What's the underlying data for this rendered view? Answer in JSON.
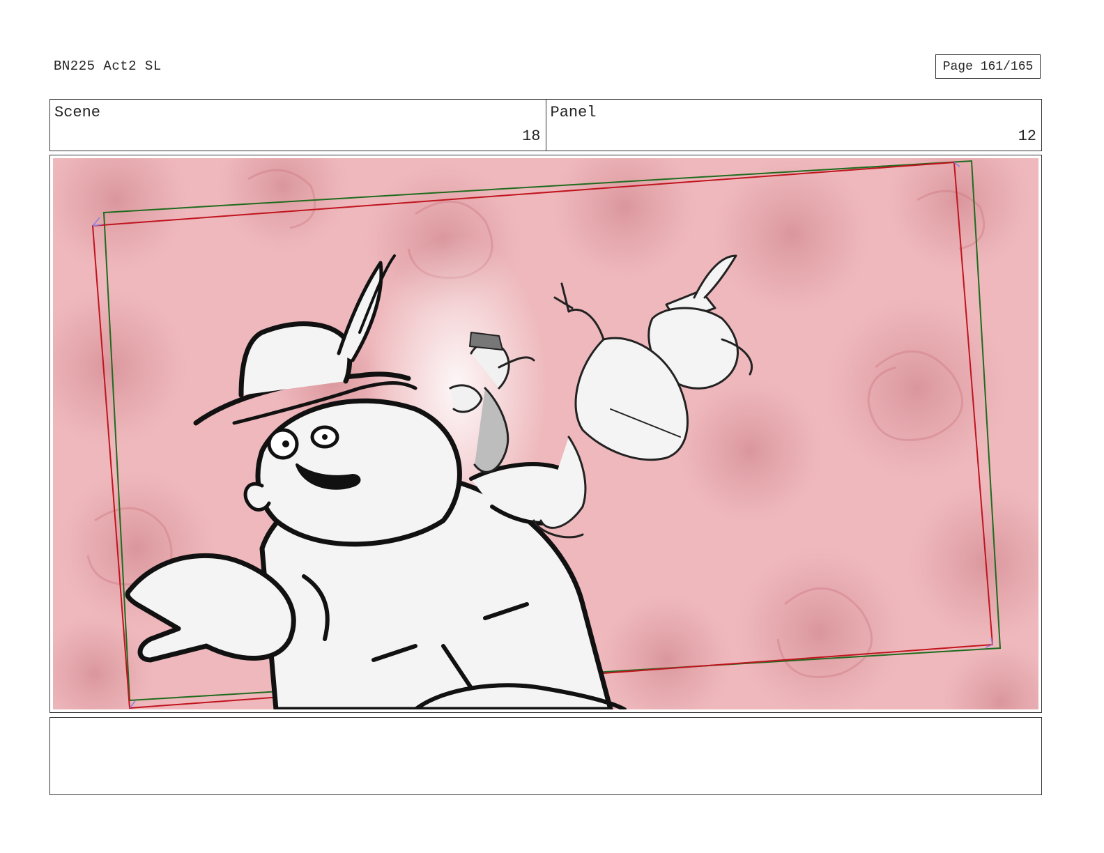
{
  "header": {
    "doc_title": "BN225 Act2 SL",
    "page_label": "Page 161/165"
  },
  "info": {
    "scene_label": "Scene",
    "scene_value": "18",
    "panel_label": "Panel",
    "panel_value": "12"
  },
  "frame": {
    "background": "red roses",
    "colors": {
      "rose_tint": "#e9a9ae",
      "rose_dark": "#c97b82",
      "camera_red": "#c0141e",
      "camera_green": "#1e6b1e",
      "ink": "#111111"
    }
  },
  "notes": {
    "text": ""
  }
}
